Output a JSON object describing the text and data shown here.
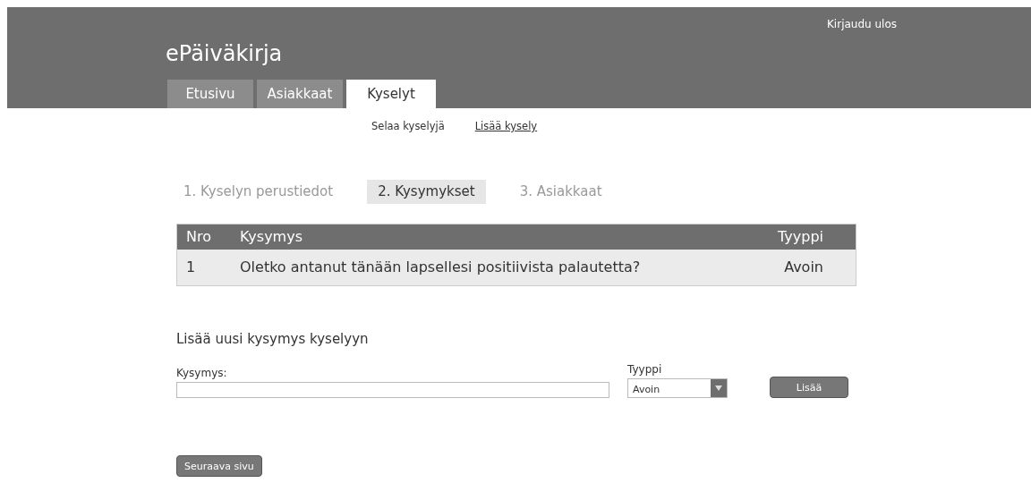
{
  "header": {
    "logout": "Kirjaudu ulos",
    "title": "ePäiväkirja"
  },
  "tabs": [
    {
      "label": "Etusivu",
      "selected": false
    },
    {
      "label": "Asiakkaat",
      "selected": false
    },
    {
      "label": "Kyselyt",
      "selected": true
    }
  ],
  "subnav": [
    {
      "label": "Selaa kyselyjä",
      "selected": false
    },
    {
      "label": "Lisää kysely",
      "selected": true
    }
  ],
  "steps": [
    {
      "label": "1. Kyselyn perustiedot",
      "selected": false
    },
    {
      "label": "2. Kysymykset",
      "selected": true
    },
    {
      "label": "3. Asiakkaat",
      "selected": false
    }
  ],
  "table": {
    "columns": [
      "Nro",
      "Kysymys",
      "Tyyppi"
    ],
    "rows": [
      [
        "1",
        "Oletko antanut tänään lapsellesi positiivista palautetta?",
        "Avoin"
      ]
    ]
  },
  "form": {
    "heading": "Lisää uusi kysymys kyselyyn",
    "question_label": "Kysymys:",
    "type_label": "Tyyppi",
    "type_value": "Avoin",
    "add_button": "Lisää"
  },
  "next_button": "Seuraava sivu"
}
